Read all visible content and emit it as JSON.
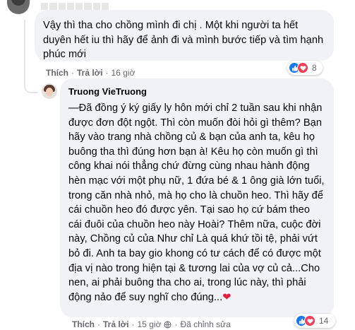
{
  "comment1": {
    "text": "Vậy thì tha cho chồng mình đi chị . Một khi người ta hết duyên hết iu thì hãy để ảnh đi và mình bước tiếp và tìm hạnh phúc mới",
    "like_label": "Thích",
    "reply_label": "Trả lời",
    "time": "16 giờ",
    "reaction_count": "8"
  },
  "comment2": {
    "author": "Truong VieTruong",
    "text": "—Đã đồng ý ký giấy ly hôn mới chỉ 2 tuần sau khi nhận được đơn đột ngột. Thì còn muốn đòi hỏi gì thêm? Bạn hãy vào trang nhà chồng củ & bạn của anh ta, kêu họ buông tha thì đúng hơn bạn à! Kêu họ còn muốn gì thì công khai nói thẳng chứ đừng cùng nhau hành động hèn mạc với một phụ nữ, 1 đứa bé & 1 ông già lớn tuổi, trong căn nhà nhỏ, mà họ cho là chuồn heo. Thì hãy để cái chuồn heo đó được yên. Tại sao họ cứ bám theo cái đuôi của chuồn heo này Hoài? Thêm nữa, cuộc đời này, Chồng củ của Như chỉ Là quá khứ tồi tệ, phải vứt bỏ đi. Anh ta bay gio khong có tư cách để có được một địa vị nào trong hiện tại & tương lai của vợ củ cả...Cho nen, ai phải buông tha cho ai, trong lúc này, thì phải động nảo để suy nghĩ cho đúng...",
    "heart_emoji": "❤",
    "like_label": "Thích",
    "reply_label": "Trả lời",
    "time": "15 giờ",
    "edited_label": "Đã chỉnh sửa",
    "reaction_count": "14"
  },
  "colors": {
    "bubble": "#f0f2f5",
    "meta_text": "#65676b",
    "like_blue": "#1877f2",
    "love_red": "#f33e58"
  },
  "icons": [
    "like-reaction-icon",
    "love-reaction-icon",
    "globe-icon"
  ]
}
